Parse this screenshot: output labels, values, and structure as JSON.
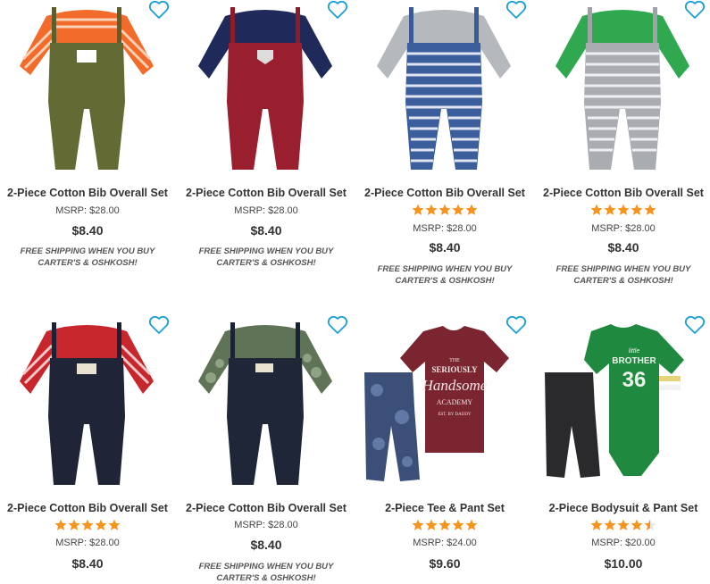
{
  "accent_colors": {
    "heart": "#1b9fd6",
    "star": "#f7941d",
    "text": "#333333"
  },
  "products": [
    {
      "title": "2-Piece Cotton Bib Overall Set",
      "rating": null,
      "msrp": "MSRP: $28.00",
      "price": "$8.40",
      "promo_line1": "FREE SHIPPING WHEN YOU BUY",
      "promo_line2": "CARTER'S & OSHKOSH!",
      "image": "olive overall with orange striped shirt"
    },
    {
      "title": "2-Piece Cotton Bib Overall Set",
      "rating": null,
      "msrp": "MSRP: $28.00",
      "price": "$8.40",
      "promo_line1": "FREE SHIPPING WHEN YOU BUY",
      "promo_line2": "CARTER'S & OSHKOSH!",
      "image": "red overall with navy shirt"
    },
    {
      "title": "2-Piece Cotton Bib Overall Set",
      "rating": 5,
      "msrp": "MSRP: $28.00",
      "price": "$8.40",
      "promo_line1": "FREE SHIPPING WHEN YOU BUY",
      "promo_line2": "CARTER'S & OSHKOSH!",
      "image": "blue striped overall with gray shirt"
    },
    {
      "title": "2-Piece Cotton Bib Overall Set",
      "rating": 5,
      "msrp": "MSRP: $28.00",
      "price": "$8.40",
      "promo_line1": "FREE SHIPPING WHEN YOU BUY",
      "promo_line2": "CARTER'S & OSHKOSH!",
      "image": "gray striped overall with green shirt"
    },
    {
      "title": "2-Piece Cotton Bib Overall Set",
      "rating": 5,
      "msrp": "MSRP: $28.00",
      "price": "$8.40",
      "promo_line1": "",
      "promo_line2": "",
      "image": "denim overall with red striped shirt"
    },
    {
      "title": "2-Piece Cotton Bib Overall Set",
      "rating": null,
      "msrp": "MSRP: $28.00",
      "price": "$8.40",
      "promo_line1": "FREE SHIPPING WHEN YOU BUY",
      "promo_line2": "CARTER'S & OSHKOSH!",
      "image": "navy overall with camo shirt"
    },
    {
      "title": "2-Piece Tee & Pant Set",
      "rating": 5,
      "msrp": "MSRP: $24.00",
      "price": "$9.60",
      "promo_line1": "",
      "promo_line2": "",
      "image": "maroon tee with camo pants"
    },
    {
      "title": "2-Piece Bodysuit & Pant Set",
      "rating": 4.5,
      "msrp": "MSRP: $20.00",
      "price": "$10.00",
      "promo_line1": "",
      "promo_line2": "",
      "image": "green bodysuit with black pants"
    }
  ],
  "graphics": {
    "tee_text_1": "THE",
    "tee_text_2": "SERIOUSLY",
    "tee_text_3": "Handsome",
    "tee_text_4": "ACADEMY",
    "tee_text_5": "EST. BY DADDY",
    "bodysuit_text_1": "little",
    "bodysuit_text_2": "BROTHER",
    "bodysuit_text_3": "36"
  }
}
